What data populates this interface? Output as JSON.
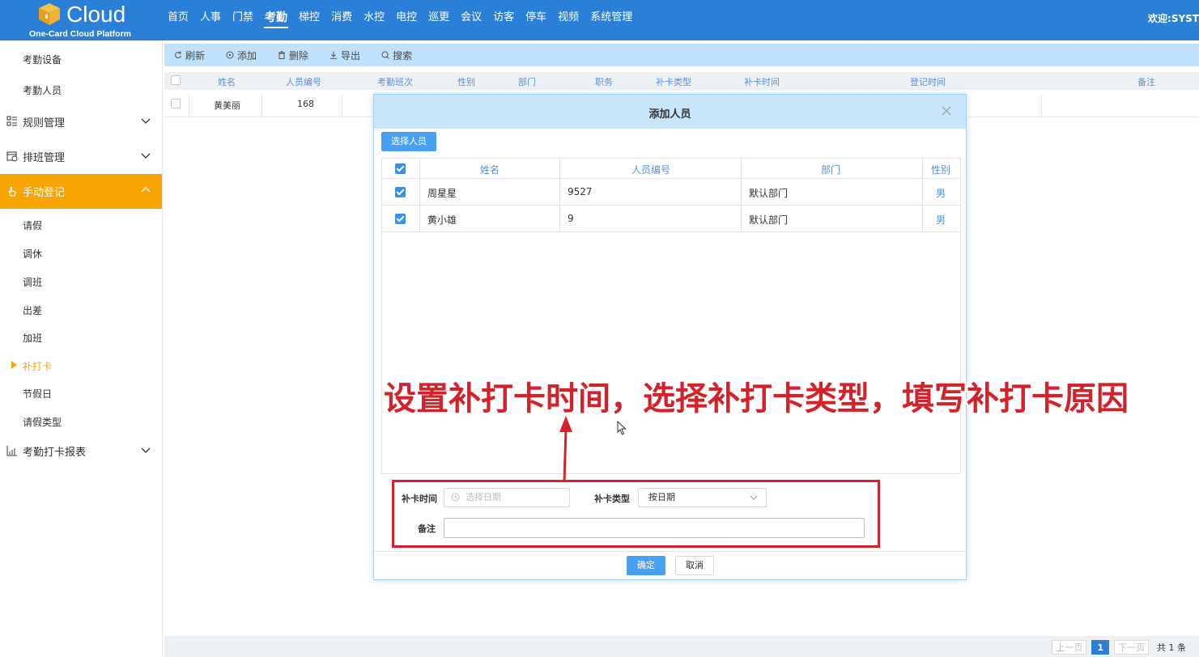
{
  "header": {
    "logo_text": "Cloud",
    "logo_sub": "One-Card Cloud Platform",
    "nav": [
      "首页",
      "人事",
      "门禁",
      "考勤",
      "梯控",
      "消费",
      "水控",
      "电控",
      "巡更",
      "会议",
      "访客",
      "停车",
      "视频",
      "系统管理"
    ],
    "active_nav": "考勤",
    "welcome": "欢迎:SYST"
  },
  "sidebar": {
    "top_items": [
      "考勤设备",
      "考勤人员"
    ],
    "groups": {
      "rules": "规则管理",
      "shift": "排班管理",
      "manual": "手动登记",
      "report": "考勤打卡报表"
    },
    "manual_items": [
      "请假",
      "调休",
      "调班",
      "出差",
      "加班",
      "补打卡",
      "节假日",
      "请假类型"
    ],
    "current_item": "补打卡"
  },
  "toolbar": {
    "refresh": "刷新",
    "add": "添加",
    "delete": "删除",
    "export": "导出",
    "search": "搜索"
  },
  "grid": {
    "columns": [
      "姓名",
      "人员编号",
      "考勤班次",
      "性别",
      "部门",
      "职务",
      "补卡类型",
      "补卡时间",
      "登记时间",
      "备注"
    ],
    "rows": [
      {
        "name": "黄美丽",
        "id": "168"
      }
    ]
  },
  "pager": {
    "prev": "上一页",
    "current": "1",
    "next": "下一页",
    "total": "共 1 条"
  },
  "dialog": {
    "title": "添加人员",
    "select_button": "选择人员",
    "columns": [
      "姓名",
      "人员编号",
      "部门",
      "性别"
    ],
    "rows": [
      {
        "name": "周星星",
        "id": "9527",
        "dept": "默认部门",
        "gender": "男"
      },
      {
        "name": "黄小雄",
        "id": "9",
        "dept": "默认部门",
        "gender": "男"
      }
    ],
    "form": {
      "time_label": "补卡时间",
      "time_placeholder": "选择日期",
      "type_label": "补卡类型",
      "type_value": "按日期",
      "remark_label": "备注",
      "remark_value": ""
    },
    "ok": "确定",
    "cancel": "取消"
  },
  "annotation": {
    "text": "设置补打卡时间，选择补打卡类型，填写补打卡原因",
    "color": "#d3222a"
  },
  "colors": {
    "header_bg": "#2a80d6",
    "active_menu": "#f7a404",
    "toolbar_bg": "#bfe1fb",
    "primary_button": "#4aa0f0"
  }
}
